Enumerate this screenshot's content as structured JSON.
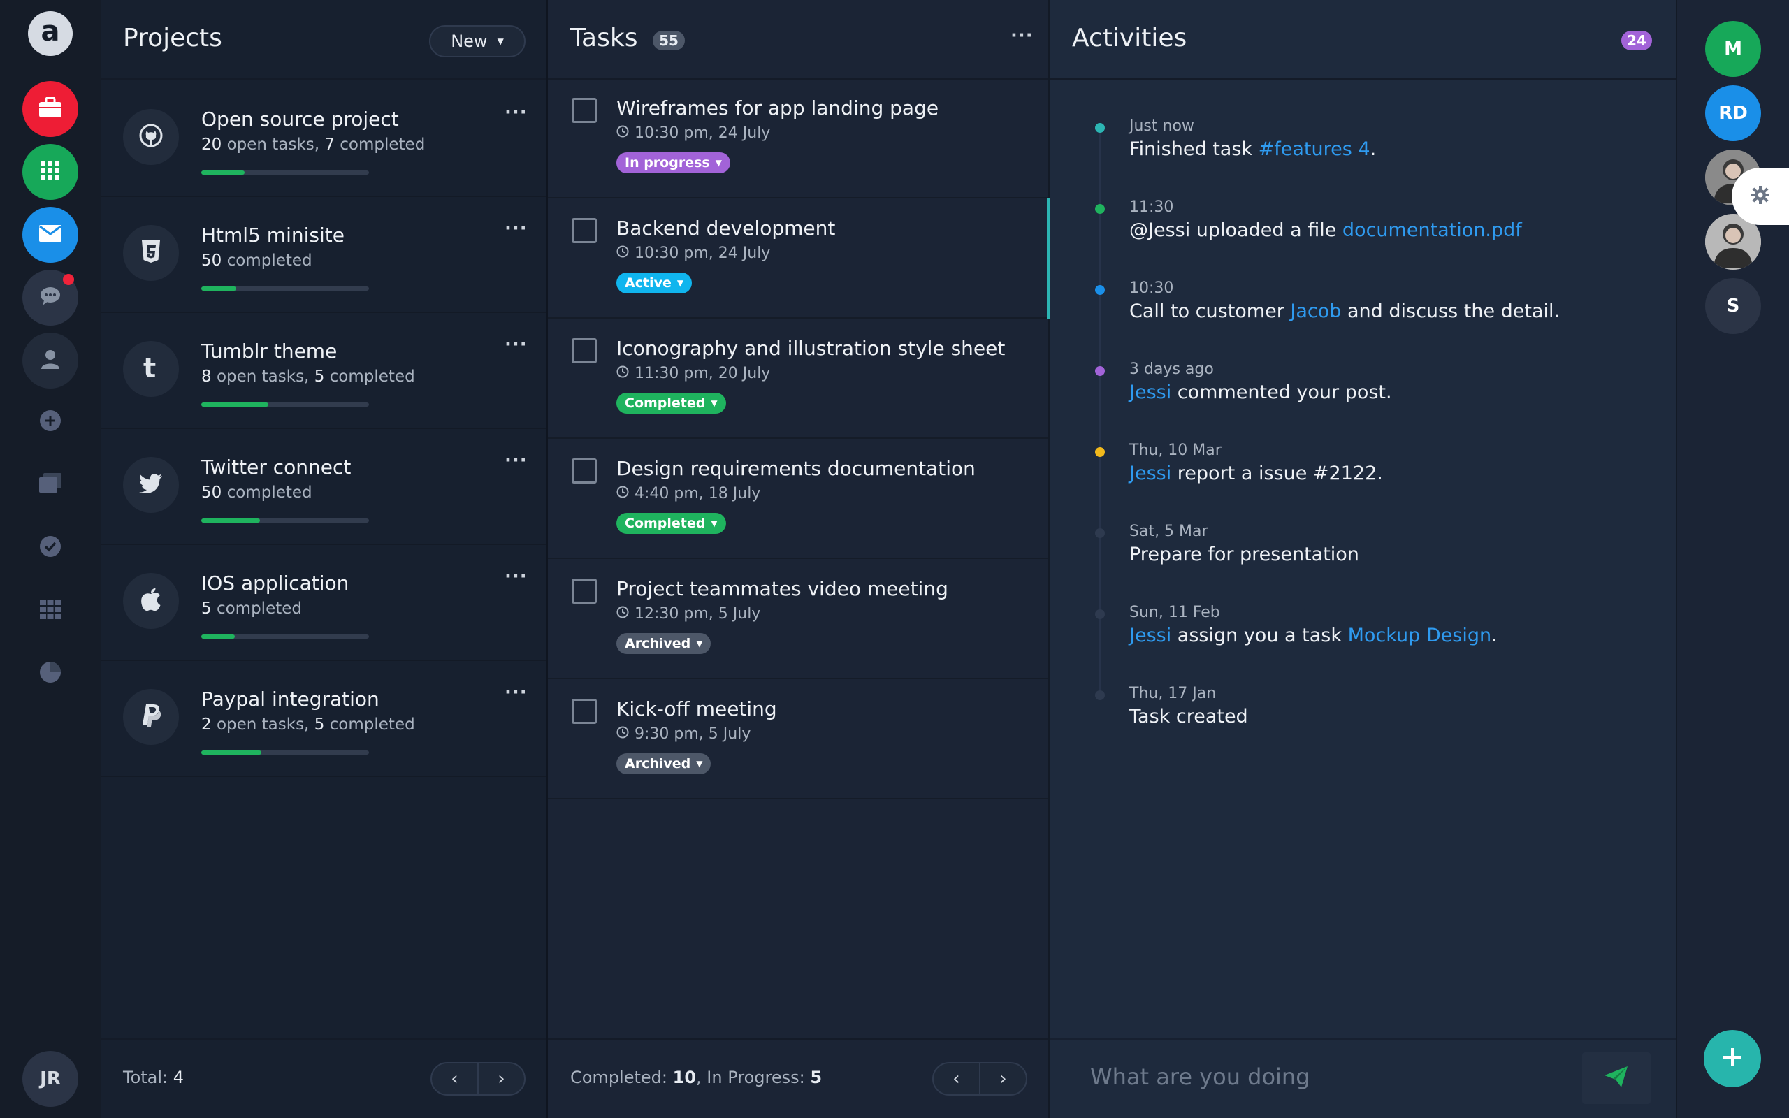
{
  "rail": {
    "brand_letter": "a",
    "items": [
      {
        "icon": "briefcase-icon",
        "color": "#ee1d35"
      },
      {
        "icon": "grid-icon",
        "color": "#17a859"
      },
      {
        "icon": "mail-icon",
        "color": "#1a8fe8"
      },
      {
        "icon": "chat-icon",
        "color": "#2b3446",
        "has_notification": true
      },
      {
        "icon": "user-icon"
      },
      {
        "icon": "plus-circle-icon"
      },
      {
        "icon": "layers-icon"
      },
      {
        "icon": "check-circle-icon"
      },
      {
        "icon": "table-icon"
      },
      {
        "icon": "pie-chart-icon"
      }
    ],
    "user_initials": "JR"
  },
  "projects": {
    "title": "Projects",
    "new_label": "New",
    "items": [
      {
        "icon": "github-icon",
        "name": "Open source project",
        "open": "20",
        "open_label": " open tasks, ",
        "done": "7",
        "done_label": " completed",
        "progress": 0.26
      },
      {
        "icon": "html5-icon",
        "name": "Html5 minisite",
        "open": "",
        "open_label": "",
        "done": "50",
        "done_label": " completed",
        "progress": 0.21
      },
      {
        "icon": "tumblr-icon",
        "name": "Tumblr theme",
        "open": "8",
        "open_label": " open tasks, ",
        "done": "5",
        "done_label": " completed",
        "progress": 0.4
      },
      {
        "icon": "twitter-icon",
        "name": "Twitter connect",
        "open": "",
        "open_label": "",
        "done": "50",
        "done_label": " completed",
        "progress": 0.35
      },
      {
        "icon": "apple-icon",
        "name": "IOS application",
        "open": "",
        "open_label": "",
        "done": "5",
        "done_label": " completed",
        "progress": 0.2
      },
      {
        "icon": "paypal-icon",
        "name": "Paypal integration",
        "open": "2",
        "open_label": " open tasks, ",
        "done": "5",
        "done_label": " completed",
        "progress": 0.36
      }
    ],
    "footer_label": "Total: ",
    "footer_value": "4"
  },
  "tasks": {
    "title": "Tasks",
    "count": "55",
    "items": [
      {
        "title": "Wireframes for app landing page",
        "time": "10:30 pm, 24 July",
        "status": "In progress",
        "status_color": "#a263d8"
      },
      {
        "title": "Backend development",
        "time": "10:30 pm, 24 July",
        "status": "Active",
        "status_color": "#10b5ee",
        "selected": true
      },
      {
        "title": "Iconography and illustration style sheet",
        "time": "11:30 pm, 20 July",
        "status": "Completed",
        "status_color": "#1fb35e"
      },
      {
        "title": "Design requirements documentation",
        "time": "4:40 pm, 18 July",
        "status": "Completed",
        "status_color": "#1fb35e"
      },
      {
        "title": "Project teammates video meeting",
        "time": "12:30 pm, 5 July",
        "status": "Archived",
        "status_color": "#4d5768"
      },
      {
        "title": "Kick-off meeting",
        "time": "9:30 pm, 5 July",
        "status": "Archived",
        "status_color": "#4d5768"
      }
    ],
    "footer": {
      "completed_label": "Completed: ",
      "completed_value": "10",
      "progress_label": ", In Progress: ",
      "progress_value": "5"
    }
  },
  "activities": {
    "title": "Activities",
    "count": "24",
    "items": [
      {
        "time": "Just now",
        "dot_color": "#2cb5b3",
        "parts": [
          {
            "t": "Finished task "
          },
          {
            "t": "#features 4",
            "link": true
          },
          {
            "t": "."
          }
        ]
      },
      {
        "time": "11:30",
        "dot_color": "#1fb35e",
        "parts": [
          {
            "t": "@Jessi uploaded a file "
          },
          {
            "t": "documentation.pdf",
            "link": true
          }
        ]
      },
      {
        "time": "10:30",
        "dot_color": "#1a8fe8",
        "parts": [
          {
            "t": "Call to customer "
          },
          {
            "t": "Jacob",
            "link": true
          },
          {
            "t": " and discuss the detail."
          }
        ]
      },
      {
        "time": "3 days ago",
        "dot_color": "#a263d8",
        "parts": [
          {
            "t": "Jessi",
            "link": true
          },
          {
            "t": " commented your post."
          }
        ]
      },
      {
        "time": "Thu, 10 Mar",
        "dot_color": "#f2b91c",
        "parts": [
          {
            "t": "Jessi",
            "link": true
          },
          {
            "t": " report a issue #2122."
          }
        ]
      },
      {
        "time": "Sat, 5 Mar",
        "dot_color": "#2e3a4f",
        "parts": [
          {
            "t": "Prepare for presentation"
          }
        ]
      },
      {
        "time": "Sun, 11 Feb",
        "dot_color": "#2e3a4f",
        "parts": [
          {
            "t": "Jessi",
            "link": true
          },
          {
            "t": " assign you a task "
          },
          {
            "t": "Mockup Design",
            "link": true
          },
          {
            "t": "."
          }
        ]
      },
      {
        "time": "Thu, 17 Jan",
        "dot_color": "#2e3a4f",
        "parts": [
          {
            "t": "Task created"
          }
        ]
      }
    ],
    "compose_placeholder": "What are you doing"
  },
  "contacts": [
    {
      "initials": "M",
      "color": "#17a859"
    },
    {
      "initials": "RD",
      "color": "#1a8fe8"
    },
    {
      "initials": "",
      "color": "#8a8a8a",
      "photo": true
    },
    {
      "initials": "",
      "color": "#b8b8b8",
      "photo": true
    },
    {
      "initials": "S",
      "color": "#2b3446"
    }
  ]
}
